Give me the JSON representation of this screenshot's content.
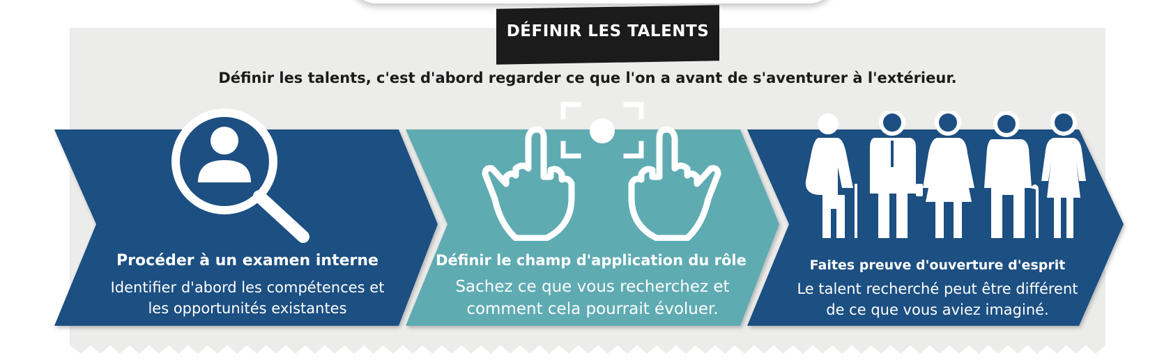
{
  "header": {
    "title": "DÉFINIR LES TALENTS",
    "subtitle": "Définir les talents, c'est d'abord regarder ce que l'on a avant de s'aventurer à l'extérieur."
  },
  "steps": [
    {
      "title": "Procéder à un examen interne",
      "desc_line1": "Identifier d'abord les compétences et",
      "desc_line2": "les opportunités existantes",
      "icon": "magnifier-person-icon",
      "color": "#1d4f82"
    },
    {
      "title": "Définir le champ d'application du rôle",
      "desc_line1": "Sachez ce que vous recherchez et",
      "desc_line2": "comment cela pourrait évoluer.",
      "icon": "hands-focus-icon",
      "color": "#5fabb2"
    },
    {
      "title": "Faites preuve d'ouverture d'esprit",
      "desc_line1": "Le talent recherché peut être différent",
      "desc_line2": "de ce que vous aviez imaginé.",
      "icon": "diverse-people-icon",
      "color": "#1d4f82"
    }
  ],
  "colors": {
    "navy": "#1d4f82",
    "teal": "#5fabb2",
    "panel": "#ececea",
    "title_bg": "#1b1b1b"
  }
}
